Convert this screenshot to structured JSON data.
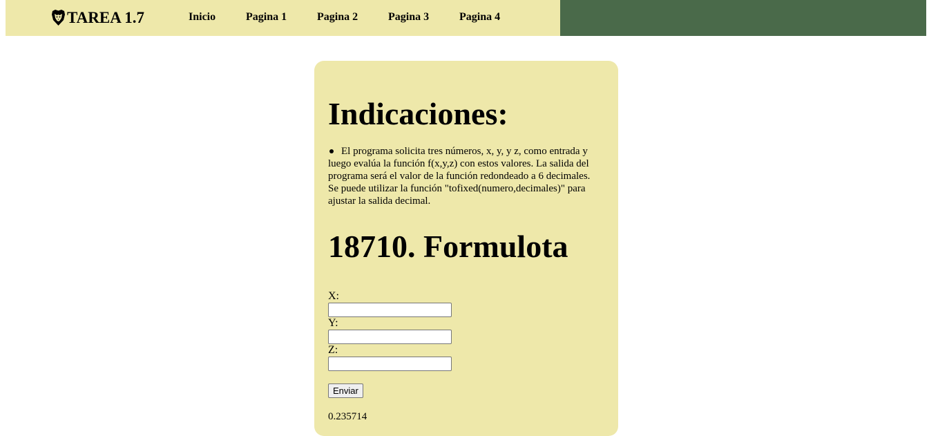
{
  "header": {
    "brand": "TAREA 1.7",
    "brand_icon": "lion-shield-icon",
    "nav": [
      "Inicio",
      "Pagina 1",
      "Pagina 2",
      "Pagina 3",
      "Pagina 4"
    ]
  },
  "content": {
    "instructions_title": "Indicaciones:",
    "instructions_item": "El programa solicita tres números, x, y, y z, como entrada y luego evalúa la función f(x,y,z) con estos valores. La salida del programa será el valor de la función redondeado a 6 decimales. Se puede utilizar la función \"tofixed(numero,decimales)\" para ajustar la salida decimal.",
    "problem_title": "18710. Formulota",
    "form": {
      "x_label": "X:",
      "x_value": "",
      "y_label": "Y:",
      "y_value": "",
      "z_label": "Z:",
      "z_value": "",
      "submit_label": "Enviar"
    },
    "result": "0.235714"
  },
  "colors": {
    "panel": "#eee8aa",
    "header_dark": "#4a6a4a"
  }
}
